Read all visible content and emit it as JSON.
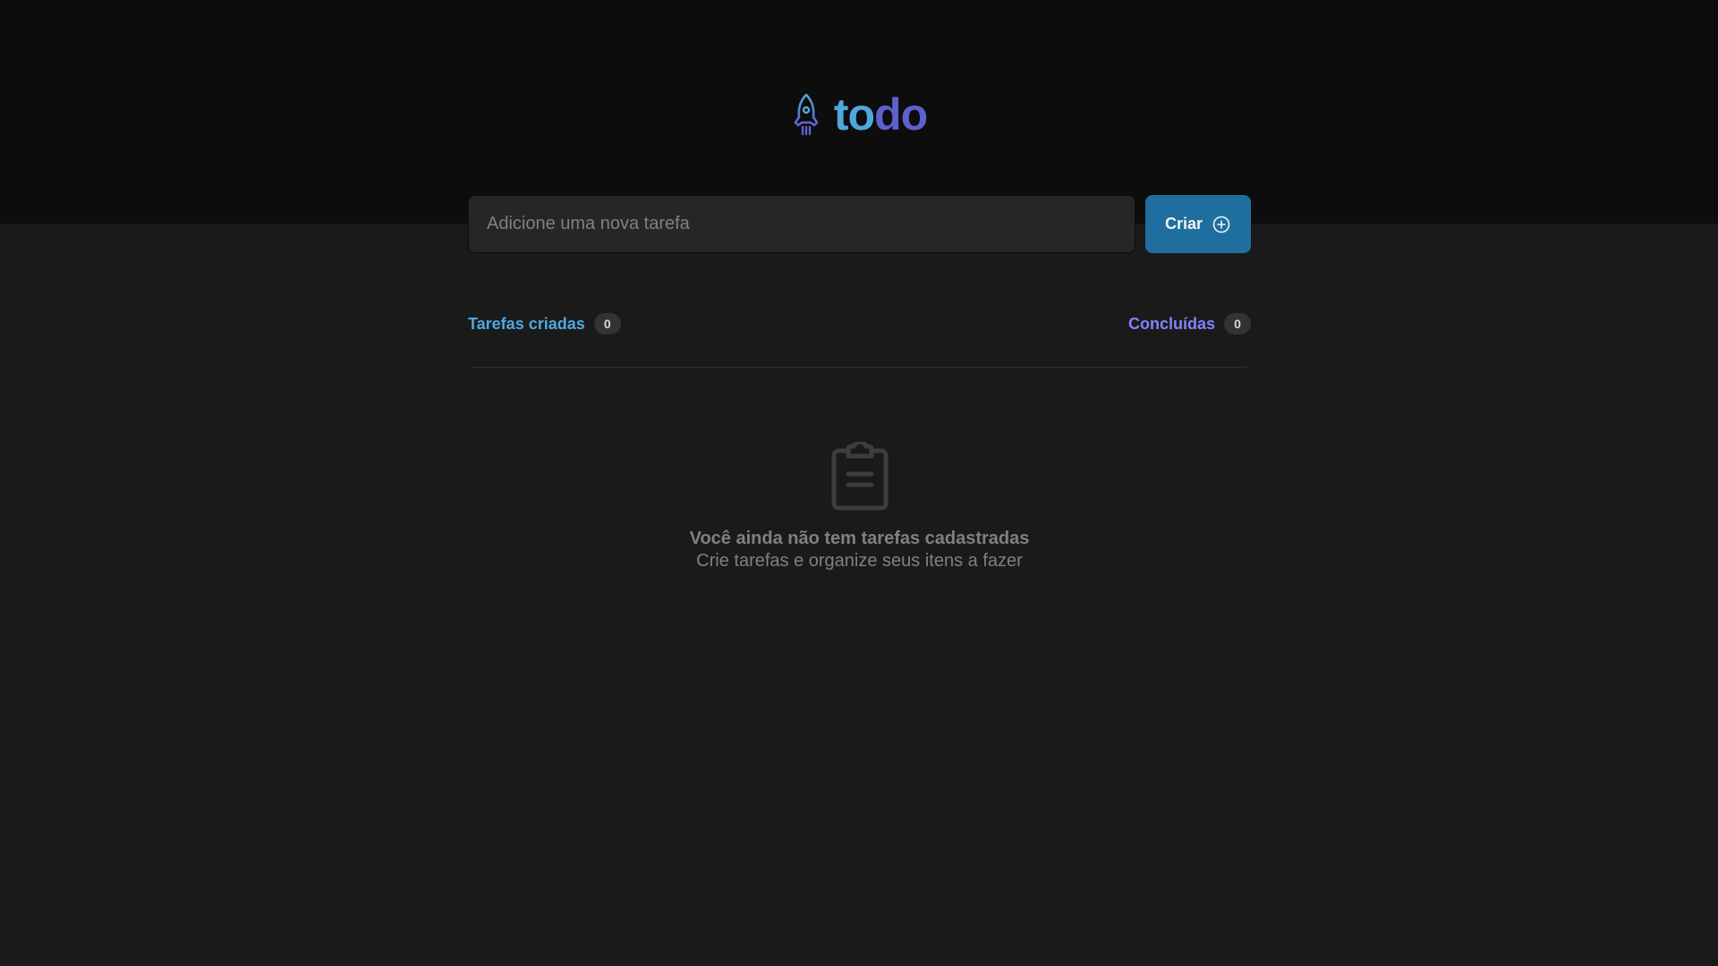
{
  "header": {
    "logo": {
      "icon": "rocket-icon",
      "text_part1": "to",
      "text_part2": "do",
      "colors": {
        "part1": "#4ea8de",
        "part2": "#5e60ce"
      }
    }
  },
  "form": {
    "input": {
      "placeholder": "Adicione uma nova tarefa",
      "value": ""
    },
    "create_button": {
      "label": "Criar",
      "icon": "plus-circle-icon",
      "color": "#1e6f9f"
    }
  },
  "counters": {
    "created": {
      "label": "Tarefas criadas",
      "count": "0"
    },
    "completed": {
      "label": "Concluídas",
      "count": "0"
    }
  },
  "empty_state": {
    "icon": "clipboard-icon",
    "title": "Você ainda não tem tarefas cadastradas",
    "subtitle": "Crie tarefas e organize seus itens a fazer"
  }
}
